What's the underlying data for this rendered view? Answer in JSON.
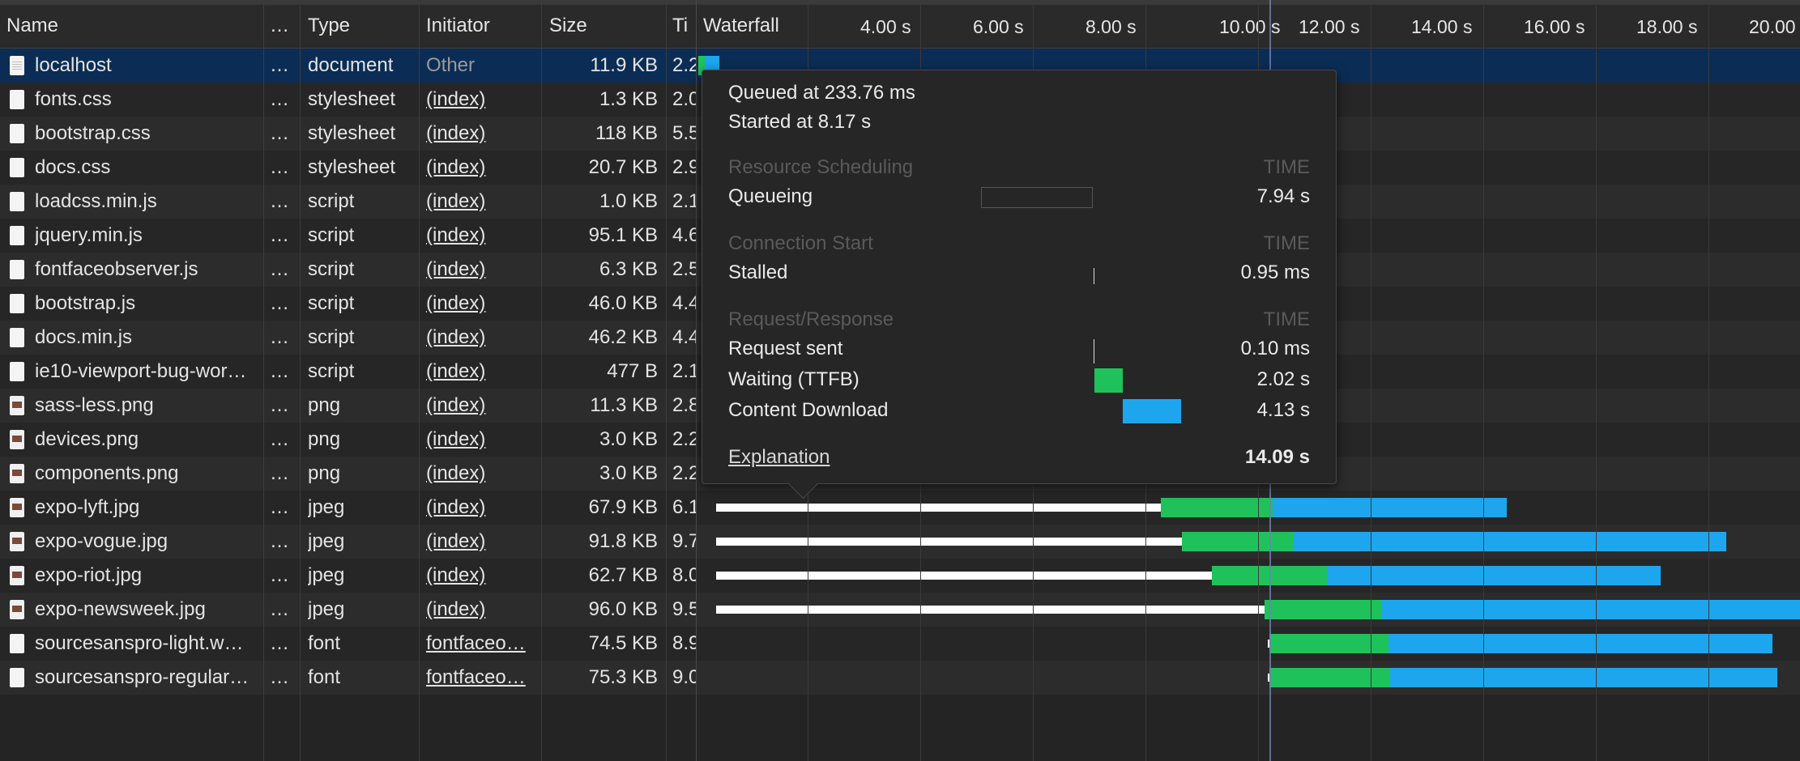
{
  "headers": {
    "name": "Name",
    "dots": "…",
    "type": "Type",
    "initiator": "Initiator",
    "size": "Size",
    "time": "Ti",
    "waterfall": "Waterfall"
  },
  "timeline_ticks": [
    "4.00 s",
    "6.00 s",
    "8.00 s",
    "10.00 s",
    "12.00 s",
    "14.00 s",
    "16.00 s",
    "18.00 s",
    "20.00"
  ],
  "rows": [
    {
      "name": "localhost",
      "dots": "…",
      "type": "document",
      "initiator": "Other",
      "size": "11.9 KB",
      "time": "2.2",
      "icon": "document-icon"
    },
    {
      "name": "fonts.css",
      "dots": "…",
      "type": "stylesheet",
      "initiator": "(index)",
      "size": "1.3 KB",
      "time": "2.0",
      "icon": "file-icon"
    },
    {
      "name": "bootstrap.css",
      "dots": "…",
      "type": "stylesheet",
      "initiator": "(index)",
      "size": "118 KB",
      "time": "5.5",
      "icon": "file-icon"
    },
    {
      "name": "docs.css",
      "dots": "…",
      "type": "stylesheet",
      "initiator": "(index)",
      "size": "20.7 KB",
      "time": "2.9",
      "icon": "file-icon"
    },
    {
      "name": "loadcss.min.js",
      "dots": "…",
      "type": "script",
      "initiator": "(index)",
      "size": "1.0 KB",
      "time": "2.1",
      "icon": "file-icon"
    },
    {
      "name": "jquery.min.js",
      "dots": "…",
      "type": "script",
      "initiator": "(index)",
      "size": "95.1 KB",
      "time": "4.6",
      "icon": "file-icon"
    },
    {
      "name": "fontfaceobserver.js",
      "dots": "…",
      "type": "script",
      "initiator": "(index)",
      "size": "6.3 KB",
      "time": "2.5",
      "icon": "file-icon"
    },
    {
      "name": "bootstrap.js",
      "dots": "…",
      "type": "script",
      "initiator": "(index)",
      "size": "46.0 KB",
      "time": "4.4",
      "icon": "file-icon"
    },
    {
      "name": "docs.min.js",
      "dots": "…",
      "type": "script",
      "initiator": "(index)",
      "size": "46.2 KB",
      "time": "4.4",
      "icon": "file-icon"
    },
    {
      "name": "ie10-viewport-bug-wor…",
      "dots": "…",
      "type": "script",
      "initiator": "(index)",
      "size": "477 B",
      "time": "2.1",
      "icon": "file-icon"
    },
    {
      "name": "sass-less.png",
      "dots": "…",
      "type": "png",
      "initiator": "(index)",
      "size": "11.3 KB",
      "time": "2.8",
      "icon": "image-icon"
    },
    {
      "name": "devices.png",
      "dots": "…",
      "type": "png",
      "initiator": "(index)",
      "size": "3.0 KB",
      "time": "2.2",
      "icon": "image-icon"
    },
    {
      "name": "components.png",
      "dots": "…",
      "type": "png",
      "initiator": "(index)",
      "size": "3.0 KB",
      "time": "2.2",
      "icon": "image-icon"
    },
    {
      "name": "expo-lyft.jpg",
      "dots": "…",
      "type": "jpeg",
      "initiator": "(index)",
      "size": "67.9 KB",
      "time": "6.1",
      "icon": "image-icon"
    },
    {
      "name": "expo-vogue.jpg",
      "dots": "…",
      "type": "jpeg",
      "initiator": "(index)",
      "size": "91.8 KB",
      "time": "9.7",
      "icon": "image-icon"
    },
    {
      "name": "expo-riot.jpg",
      "dots": "…",
      "type": "jpeg",
      "initiator": "(index)",
      "size": "62.7 KB",
      "time": "8.0",
      "icon": "image-icon"
    },
    {
      "name": "expo-newsweek.jpg",
      "dots": "…",
      "type": "jpeg",
      "initiator": "(index)",
      "size": "96.0 KB",
      "time": "9.5",
      "icon": "image-icon"
    },
    {
      "name": "sourcesanspro-light.w…",
      "dots": "…",
      "type": "font",
      "initiator": "fontfaceo…",
      "size": "74.5 KB",
      "time": "8.9",
      "icon": "file-icon"
    },
    {
      "name": "sourcesanspro-regular…",
      "dots": "…",
      "type": "font",
      "initiator": "fontfaceo…",
      "size": "75.3 KB",
      "time": "9.0",
      "icon": "file-icon"
    }
  ],
  "tooltip": {
    "queued": "Queued at 233.76 ms",
    "started": "Started at 8.17 s",
    "sections": [
      {
        "title": "Resource Scheduling",
        "time_head": "TIME",
        "items": [
          {
            "label": "Queueing",
            "value": "7.94 s"
          }
        ]
      },
      {
        "title": "Connection Start",
        "time_head": "TIME",
        "items": [
          {
            "label": "Stalled",
            "value": "0.95 ms"
          }
        ]
      },
      {
        "title": "Request/Response",
        "time_head": "TIME",
        "items": [
          {
            "label": "Request sent",
            "value": "0.10 ms"
          },
          {
            "label": "Waiting (TTFB)",
            "value": "2.02 s"
          },
          {
            "label": "Content Download",
            "value": "4.13 s"
          }
        ]
      }
    ],
    "explanation": "Explanation",
    "total": "14.09 s"
  },
  "colors": {
    "waiting": "#1fc25a",
    "download": "#1da6ee",
    "selected_row": "#0b2d55"
  }
}
